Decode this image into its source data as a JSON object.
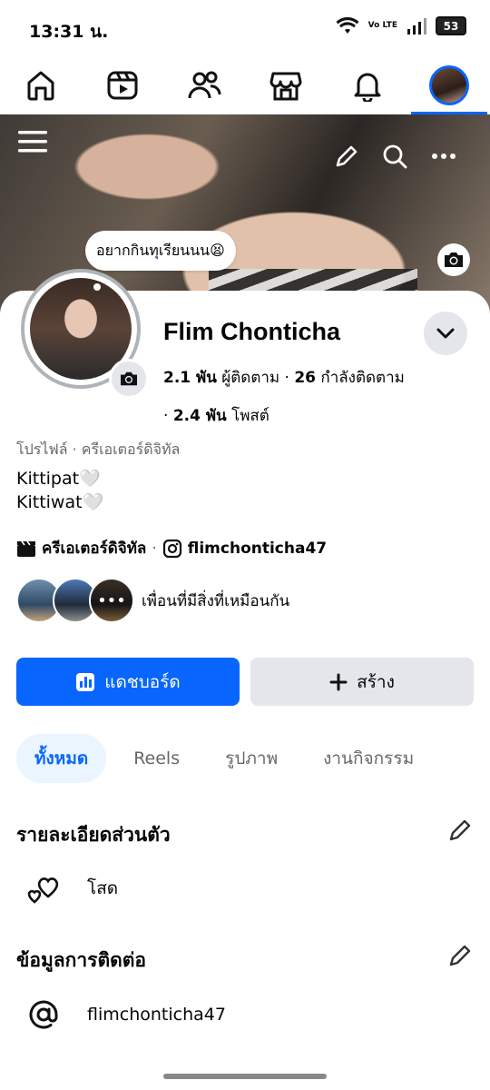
{
  "status_bar": {
    "time": "13:31 น.",
    "volte": "Vo LTE",
    "battery": "53"
  },
  "nav": [
    "home-icon",
    "reels-icon",
    "friends-icon",
    "marketplace-icon",
    "notifications-icon",
    "profile-avatar"
  ],
  "note": {
    "text": "อยากกินทุเรียนนน😫"
  },
  "profile": {
    "name": "Flim Chonticha",
    "followers_count": "2.1 พัน",
    "followers_label": "ผู้ติดตาม",
    "following_count": "26",
    "following_label": "กำลังติดตาม",
    "posts_count": "2.4 พัน",
    "posts_label": "โพสต์",
    "subtitle": "โปรไฟล์ · ครีเอเตอร์ดิจิทัล",
    "bio_line1": "Kittipat🤍",
    "bio_line2": "Kittiwat🤍",
    "category": "ครีเอเตอร์ดิจิทัล",
    "instagram": "flimchonticha47",
    "mutual_text": "เพื่อนที่มีสิ่งที่เหมือนกัน"
  },
  "buttons": {
    "dashboard": "แดชบอร์ด",
    "create": "สร้าง"
  },
  "tabs": [
    "ทั้งหมด",
    "Reels",
    "รูปภาพ",
    "งานกิจกรรม"
  ],
  "personal": {
    "title": "รายละเอียดส่วนตัว",
    "relationship": "โสด"
  },
  "contact": {
    "title": "ข้อมูลการติดต่อ",
    "instagram": "flimchonticha47"
  },
  "colors": {
    "accent": "#0866ff",
    "button_gray": "#e4e6eb",
    "tab_active_bg": "#ebf5ff"
  }
}
